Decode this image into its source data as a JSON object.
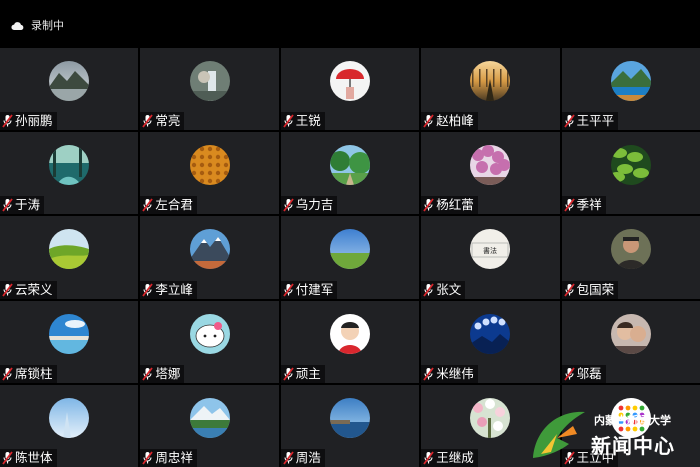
{
  "header": {
    "recording_label": "录制中",
    "recording_icon": "cloud-icon"
  },
  "participants": [
    {
      "name": "孙丽鹏",
      "avatar": "mountain-lake"
    },
    {
      "name": "常亮",
      "avatar": "waterfall-statue"
    },
    {
      "name": "王锐",
      "avatar": "red-umbrella"
    },
    {
      "name": "赵柏峰",
      "avatar": "sunset-road"
    },
    {
      "name": "王平平",
      "avatar": "mountain-lake-blue"
    },
    {
      "name": "于涛",
      "avatar": "forest-stream"
    },
    {
      "name": "左合君",
      "avatar": "orange-texture"
    },
    {
      "name": "乌力吉",
      "avatar": "forest-path"
    },
    {
      "name": "杨红蕾",
      "avatar": "pink-blossoms"
    },
    {
      "name": "季祥",
      "avatar": "green-leaves"
    },
    {
      "name": "云荣义",
      "avatar": "green-field"
    },
    {
      "name": "李立峰",
      "avatar": "snow-mountain"
    },
    {
      "name": "付建军",
      "avatar": "grassland-sky"
    },
    {
      "name": "张文",
      "avatar": "calligraphy"
    },
    {
      "name": "包国荣",
      "avatar": "portrait-man"
    },
    {
      "name": "席锁柱",
      "avatar": "blue-sky-lake"
    },
    {
      "name": "塔娜",
      "avatar": "cartoon-cat"
    },
    {
      "name": "顽主",
      "avatar": "cartoon-boy"
    },
    {
      "name": "米继伟",
      "avatar": "moon-phases"
    },
    {
      "name": "邬磊",
      "avatar": "couple-photo"
    },
    {
      "name": "陈世体",
      "avatar": "light-sky"
    },
    {
      "name": "周忠祥",
      "avatar": "lake-mountain"
    },
    {
      "name": "周浩",
      "avatar": "sea-sky"
    },
    {
      "name": "王继成",
      "avatar": "spring-flowers"
    },
    {
      "name": "王立中",
      "avatar": "colorful-dots"
    }
  ],
  "mic_icon": "mic-muted-icon",
  "watermark": {
    "line1": "内蒙古新闻大学",
    "line2": "新闻中心"
  },
  "colors": {
    "tile_bg": "#202124",
    "mic_red": "#d7262c"
  }
}
